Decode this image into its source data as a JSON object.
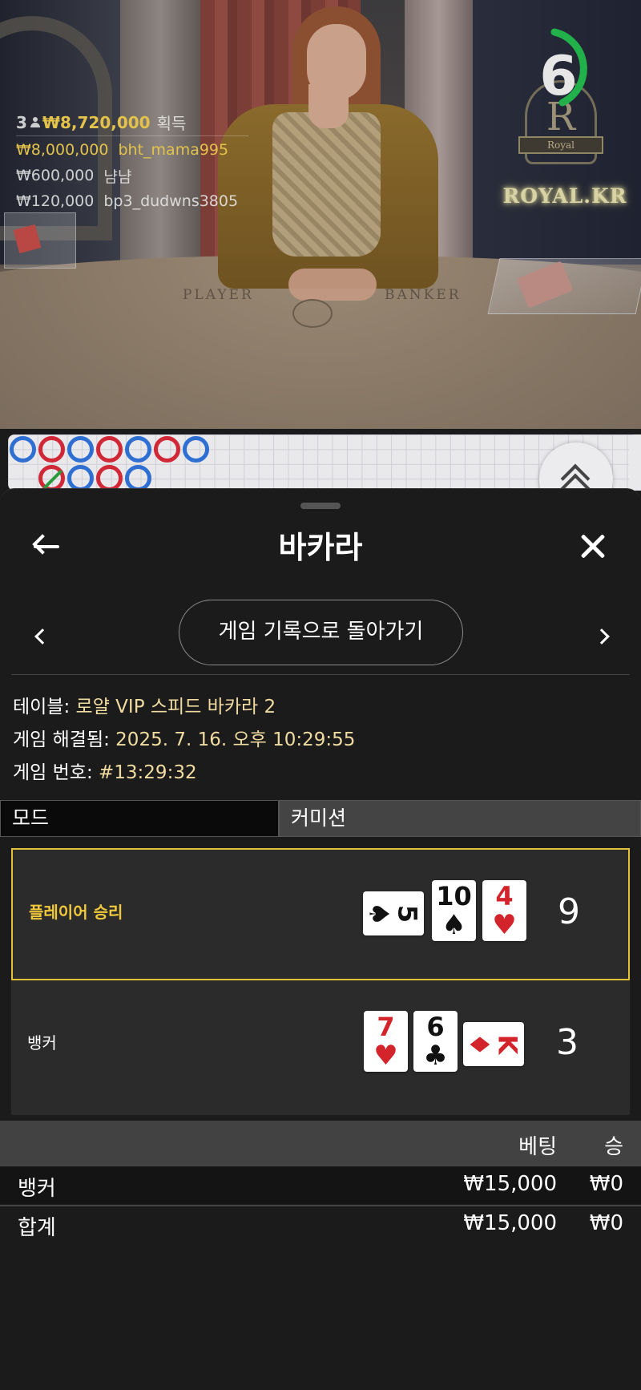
{
  "video": {
    "timer_value": "6",
    "brand": "ROYAL.KR",
    "logo_letter": "R",
    "logo_ribbon": "Royal",
    "table_player": "PLAYER",
    "table_banker": "BANKER",
    "winners": {
      "count": "3",
      "total": "₩8,720,000",
      "suffix": "획득",
      "rows": [
        {
          "amount": "₩8,000,000",
          "name": "bht_mama995"
        },
        {
          "amount": "₩600,000",
          "name": "냠냠"
        },
        {
          "amount": "₩120,000",
          "name": "bp3_dudwns3805"
        }
      ]
    }
  },
  "sheet": {
    "title": "바카라",
    "history_button": "게임 기록으로 돌아가기",
    "table_label": "테이블: ",
    "table_value": "로얄 VIP 스피드 바카라 2",
    "resolved_label": "게임 해결됨: ",
    "resolved_value": "2025. 7. 16. 오후 10:29:55",
    "game_no_label": "게임 번호: ",
    "game_no_value": "#13:29:32",
    "tabs": {
      "mode": "모드",
      "commission": "커미션"
    },
    "result": {
      "player": {
        "label": "플레이어 승리",
        "score": "9",
        "cards": [
          {
            "rank": "5",
            "suit": "♠",
            "color": "black",
            "sideways": true
          },
          {
            "rank": "10",
            "suit": "♠",
            "color": "black",
            "sideways": false
          },
          {
            "rank": "4",
            "suit": "♥",
            "color": "red",
            "sideways": false
          }
        ]
      },
      "banker": {
        "label": "뱅커",
        "score": "3",
        "cards": [
          {
            "rank": "7",
            "suit": "♥",
            "color": "red",
            "sideways": false
          },
          {
            "rank": "6",
            "suit": "♣",
            "color": "black",
            "sideways": false
          },
          {
            "rank": "K",
            "suit": "♦",
            "color": "red",
            "sideways": true
          }
        ]
      }
    },
    "bets": {
      "col_bet": "베팅",
      "col_win": "승",
      "rows": [
        {
          "label": "뱅커",
          "bet": "₩15,000",
          "win": "₩0"
        },
        {
          "label": "합계",
          "bet": "₩15,000",
          "win": "₩0"
        }
      ]
    }
  },
  "colors": {
    "accent_gold": "#e5c13a",
    "info_value": "#f0dca0",
    "timer_green": "#22b04a",
    "bead_blue": "#2e6fd1",
    "bead_red": "#d02837",
    "tie_green": "#2a9b3b"
  },
  "roadmap": {
    "beads_row1": [
      "b",
      "r",
      "b",
      "r",
      "b",
      "r",
      "b"
    ],
    "beads_row2": [
      "r-tie",
      "b",
      "r",
      "b"
    ]
  }
}
